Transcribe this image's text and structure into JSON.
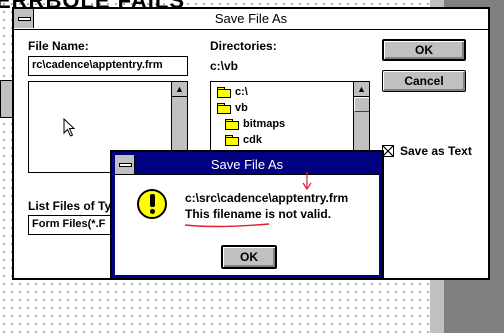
{
  "background": {
    "title_fragment": "ERRBOLE FAILS"
  },
  "save_dialog": {
    "title": "Save File As",
    "file_name_label": "File Name:",
    "file_name_value": "rc\\cadence\\apptentry.frm",
    "directories_label": "Directories:",
    "current_dir": "c:\\vb",
    "dir_items": [
      "c:\\",
      "vb",
      "bitmaps",
      "cdk"
    ],
    "list_files_label": "List Files of Ty",
    "list_files_value": "Form Files(*.F",
    "ok_label": "OK",
    "cancel_label": "Cancel",
    "save_as_text_label": "Save as Text",
    "save_as_text_checked": true
  },
  "alert_dialog": {
    "title": "Save File As",
    "path_line": "c:\\src\\cadence\\apptentry.frm",
    "message_line": "This filename is not valid.",
    "ok_label": "OK",
    "icon": "exclamation-icon"
  },
  "colors": {
    "title_active": "#000080",
    "face": "#c0c0c0",
    "annotation": "#e0202a"
  }
}
